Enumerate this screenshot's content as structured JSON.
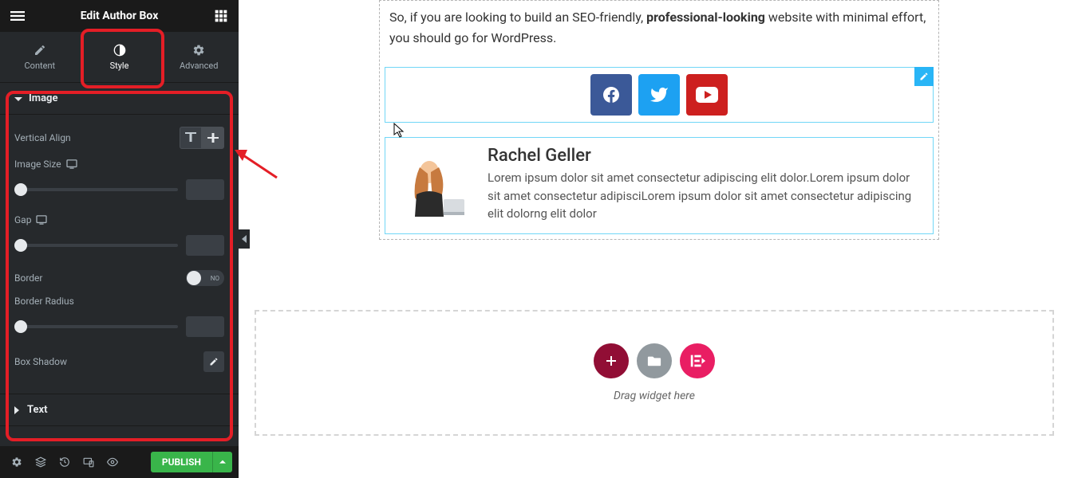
{
  "topbar": {
    "title": "Edit Author Box"
  },
  "tabs": {
    "content": "Content",
    "style": "Style",
    "advanced": "Advanced"
  },
  "sections": {
    "image": {
      "title": "Image",
      "vertical_align": "Vertical Align",
      "image_size": "Image Size",
      "gap": "Gap",
      "border": "Border",
      "border_switch": "NO",
      "border_radius": "Border Radius",
      "box_shadow": "Box Shadow"
    },
    "text": {
      "title": "Text"
    }
  },
  "bottom": {
    "publish": "PUBLISH"
  },
  "content": {
    "para_pre": "So, if you are looking to build an SEO-friendly, ",
    "para_bold": "professional-looking",
    "para_post": " website with minimal effort, you should go for WordPress."
  },
  "author": {
    "name": "Rachel Geller",
    "desc": "Lorem ipsum dolor sit amet consectetur adipiscing elit dolor.Lorem ipsum dolor sit amet consectetur adipisciLorem ipsum dolor sit amet consectetur adipiscing elit dolorng elit dolor"
  },
  "drop": {
    "text": "Drag widget here"
  }
}
